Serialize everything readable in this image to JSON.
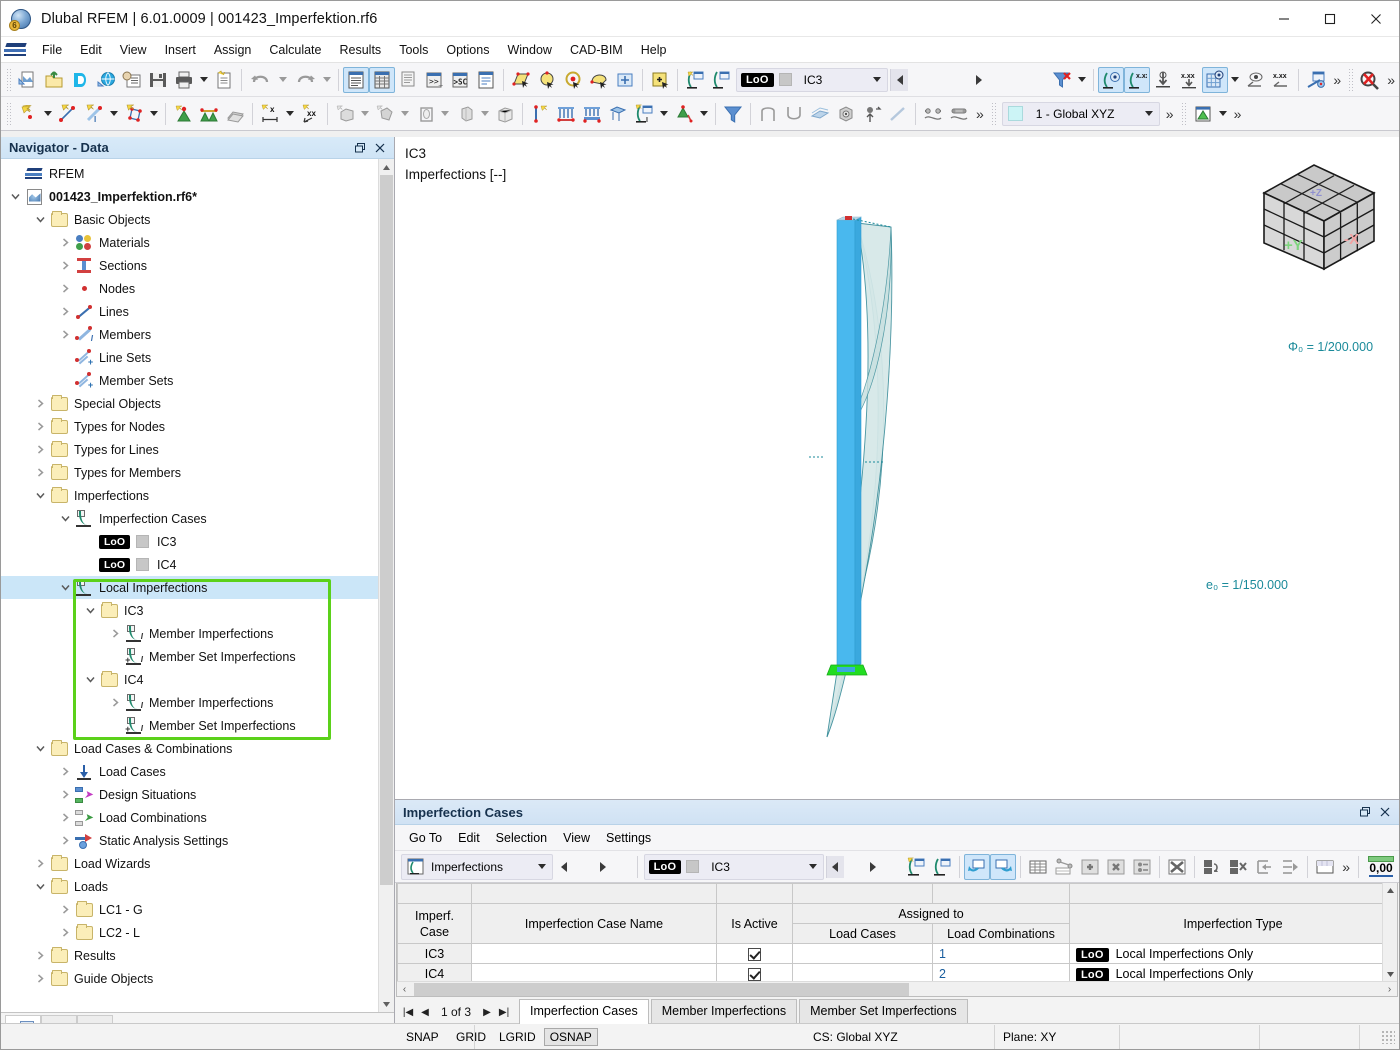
{
  "titlebar": {
    "title": "Dlubal RFEM | 6.01.0009 | 001423_Imperfektion.rf6",
    "minimize": "–",
    "maximize": "☐",
    "close": "✕"
  },
  "menubar": {
    "items": [
      "File",
      "Edit",
      "View",
      "Insert",
      "Assign",
      "Calculate",
      "Results",
      "Tools",
      "Options",
      "Window",
      "CAD-BIM",
      "Help"
    ]
  },
  "toolbar": {
    "imperfection_combo": {
      "chip": "LoO",
      "value": "IC3"
    },
    "cs_combo": {
      "value": "1 - Global XYZ"
    },
    "overflow": "»"
  },
  "navigator": {
    "title": "Navigator - Data",
    "restore_icon": "restore-icon",
    "close_icon": "close-icon",
    "tree": [
      {
        "label": "RFEM",
        "depth": 0,
        "icon": "rfem-logo-icon",
        "exp": "none",
        "bold": false
      },
      {
        "label": "001423_Imperfektion.rf6*",
        "depth": 0,
        "icon": "model-icon",
        "exp": "open",
        "bold": true
      },
      {
        "label": "Basic Objects",
        "depth": 1,
        "icon": "folder-icon",
        "exp": "open",
        "bold": false
      },
      {
        "label": "Materials",
        "depth": 2,
        "icon": "materials-icon",
        "exp": "closed",
        "bold": false
      },
      {
        "label": "Sections",
        "depth": 2,
        "icon": "sections-icon",
        "exp": "closed",
        "bold": false
      },
      {
        "label": "Nodes",
        "depth": 2,
        "icon": "node-icon",
        "exp": "closed",
        "bold": false
      },
      {
        "label": "Lines",
        "depth": 2,
        "icon": "line-icon",
        "exp": "closed",
        "bold": false
      },
      {
        "label": "Members",
        "depth": 2,
        "icon": "member-icon",
        "exp": "closed",
        "bold": false
      },
      {
        "label": "Line Sets",
        "depth": 2,
        "icon": "line-set-icon",
        "exp": "none",
        "bold": false
      },
      {
        "label": "Member Sets",
        "depth": 2,
        "icon": "member-set-icon",
        "exp": "none",
        "bold": false
      },
      {
        "label": "Special Objects",
        "depth": 1,
        "icon": "folder-icon",
        "exp": "closed",
        "bold": false
      },
      {
        "label": "Types for Nodes",
        "depth": 1,
        "icon": "folder-icon",
        "exp": "closed",
        "bold": false
      },
      {
        "label": "Types for Lines",
        "depth": 1,
        "icon": "folder-icon",
        "exp": "closed",
        "bold": false
      },
      {
        "label": "Types for Members",
        "depth": 1,
        "icon": "folder-icon",
        "exp": "closed",
        "bold": false
      },
      {
        "label": "Imperfections",
        "depth": 1,
        "icon": "folder-icon",
        "exp": "open",
        "bold": false
      },
      {
        "label": "Imperfection Cases",
        "depth": 2,
        "icon": "imperfection-icon",
        "exp": "open",
        "bold": false
      },
      {
        "label": "IC3",
        "depth": 3,
        "icon": "loo-chip",
        "exp": "none",
        "bold": false,
        "chip": "LoO"
      },
      {
        "label": "IC4",
        "depth": 3,
        "icon": "loo-chip",
        "exp": "none",
        "bold": false,
        "chip": "LoO"
      },
      {
        "label": "Local Imperfections",
        "depth": 2,
        "icon": "imperfection-icon",
        "exp": "open",
        "bold": false,
        "selected": true
      },
      {
        "label": "IC3",
        "depth": 3,
        "icon": "folder-icon",
        "exp": "open",
        "bold": false
      },
      {
        "label": "Member Imperfections",
        "depth": 4,
        "icon": "member-imperfection-icon",
        "exp": "closed",
        "bold": false
      },
      {
        "label": "Member Set Imperfections",
        "depth": 4,
        "icon": "member-set-imperfection-icon",
        "exp": "none",
        "bold": false
      },
      {
        "label": "IC4",
        "depth": 3,
        "icon": "folder-icon",
        "exp": "open",
        "bold": false
      },
      {
        "label": "Member Imperfections",
        "depth": 4,
        "icon": "member-imperfection-icon",
        "exp": "closed",
        "bold": false
      },
      {
        "label": "Member Set Imperfections",
        "depth": 4,
        "icon": "member-set-imperfection-icon",
        "exp": "none",
        "bold": false
      },
      {
        "label": "Load Cases & Combinations",
        "depth": 1,
        "icon": "folder-icon",
        "exp": "open",
        "bold": false
      },
      {
        "label": "Load Cases",
        "depth": 2,
        "icon": "load-case-icon",
        "exp": "closed",
        "bold": false
      },
      {
        "label": "Design Situations",
        "depth": 2,
        "icon": "design-situation-icon",
        "exp": "closed",
        "bold": false
      },
      {
        "label": "Load Combinations",
        "depth": 2,
        "icon": "load-combination-icon",
        "exp": "closed",
        "bold": false
      },
      {
        "label": "Static Analysis Settings",
        "depth": 2,
        "icon": "static-analysis-icon",
        "exp": "closed",
        "bold": false
      },
      {
        "label": "Load Wizards",
        "depth": 1,
        "icon": "folder-icon",
        "exp": "closed",
        "bold": false
      },
      {
        "label": "Loads",
        "depth": 1,
        "icon": "folder-icon",
        "exp": "open",
        "bold": false
      },
      {
        "label": "LC1 - G",
        "depth": 2,
        "icon": "folder-icon",
        "exp": "closed",
        "bold": false
      },
      {
        "label": "LC2 - L",
        "depth": 2,
        "icon": "folder-icon",
        "exp": "closed",
        "bold": false
      },
      {
        "label": "Results",
        "depth": 1,
        "icon": "folder-icon",
        "exp": "closed",
        "bold": false
      },
      {
        "label": "Guide Objects",
        "depth": 1,
        "icon": "folder-icon",
        "exp": "closed",
        "bold": false
      }
    ],
    "highlight_color": "#5bd11a",
    "footer_tabs": [
      "navigator-tab-data",
      "navigator-tab-display",
      "navigator-tab-views"
    ]
  },
  "viewport": {
    "title_line1": "IC3",
    "title_line2": "Imperfections [--]",
    "annotation_phi": "Φ₀ =  1/200.000",
    "annotation_e0": "e₀ =  1/150.000",
    "cube_axis_y": "+Y",
    "cube_axis_x": "-X",
    "member_color": "#49b8ee",
    "imperfection_color": "#cfe4e4",
    "annotation_color": "#1a8a9a",
    "support_color": "#22dd22"
  },
  "table_panel": {
    "title": "Imperfection Cases",
    "restore_icon": "restore-icon",
    "close_icon": "close-icon",
    "menu": [
      "Go To",
      "Edit",
      "Selection",
      "View",
      "Settings"
    ],
    "combo_left": {
      "value": "Imperfections"
    },
    "combo_right": {
      "chip": "LoO",
      "value": "IC3"
    },
    "overflow": "»",
    "numeric_badge": "0,00",
    "columns": {
      "col1_line1": "Imperf.",
      "col1_line2": "Case",
      "col2": "Imperfection Case Name",
      "col3": "Is Active",
      "group": "Assigned to",
      "col4": "Load Cases",
      "col5": "Load Combinations",
      "col6": "Imperfection Type"
    },
    "rows": [
      {
        "case": "IC3",
        "name": "",
        "active": true,
        "load_cases": "",
        "load_combinations": "1",
        "type_chip": "LoO",
        "type": "Local Imperfections Only"
      },
      {
        "case": "IC4",
        "name": "",
        "active": true,
        "load_cases": "",
        "load_combinations": "2",
        "type_chip": "LoO",
        "type": "Local Imperfections Only"
      }
    ],
    "pager": {
      "first": "|◀",
      "prev": "◀",
      "text": "1 of 3",
      "next": "▶",
      "last": "▶|"
    },
    "tabs": [
      {
        "label": "Imperfection Cases",
        "active": true
      },
      {
        "label": "Member Imperfections",
        "active": false
      },
      {
        "label": "Member Set Imperfections",
        "active": false
      }
    ]
  },
  "statusbar": {
    "snap": "SNAP",
    "grid": "GRID",
    "lgrid": "LGRID",
    "osnap": "OSNAP",
    "cs": "CS: Global XYZ",
    "plane": "Plane: XY"
  }
}
